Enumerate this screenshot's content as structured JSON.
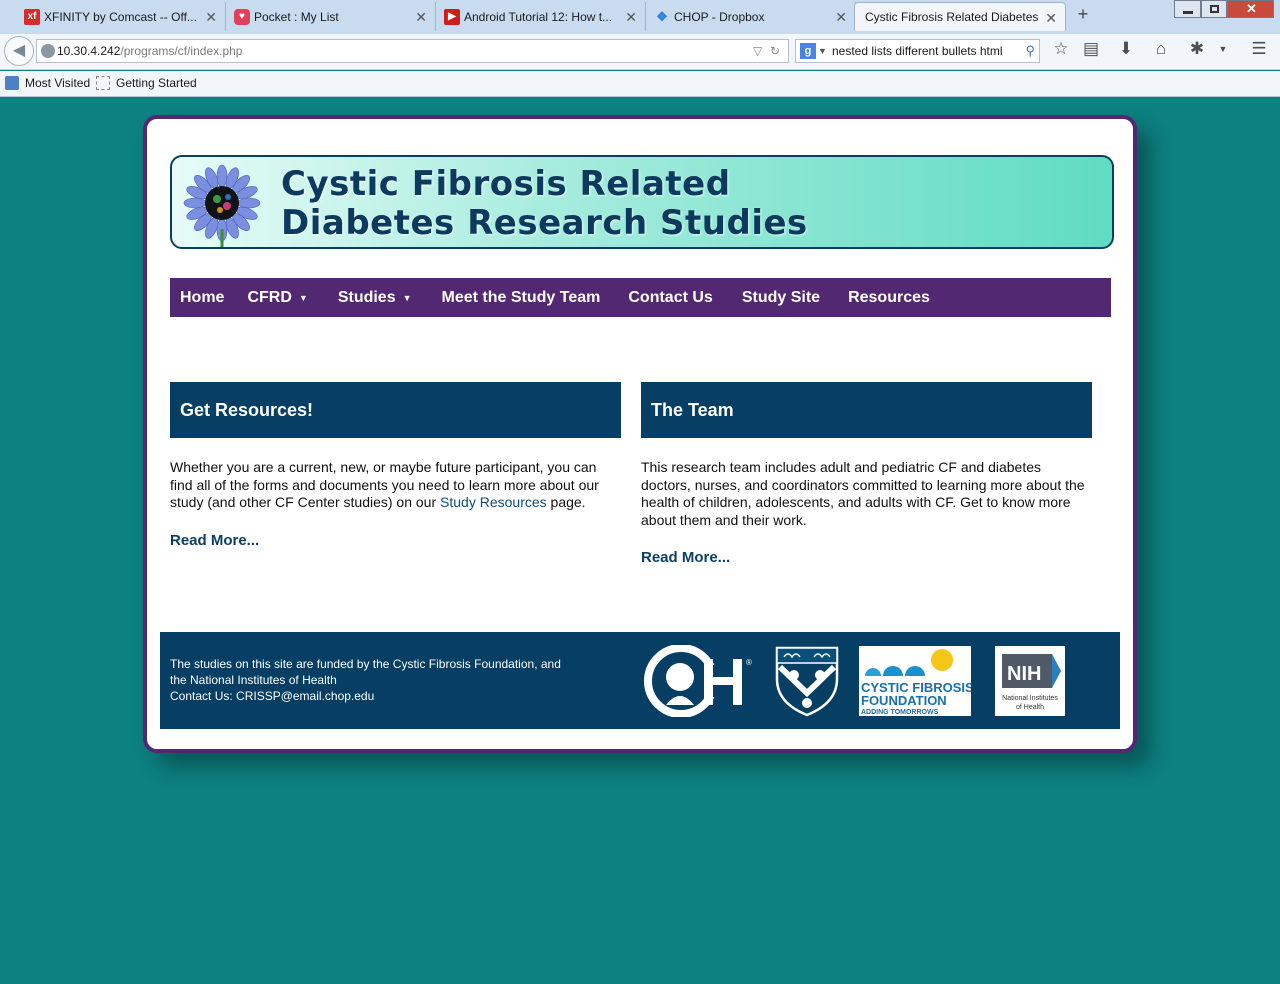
{
  "browser": {
    "tabs": [
      {
        "label": "XFINITY by Comcast -- Off...",
        "icon": "xfinity-icon",
        "active": false
      },
      {
        "label": "Pocket : My List",
        "icon": "pocket-icon",
        "active": false
      },
      {
        "label": "Android Tutorial 12: How t...",
        "icon": "youtube-icon",
        "active": false
      },
      {
        "label": "CHOP - Dropbox",
        "icon": "dropbox-icon",
        "active": false
      },
      {
        "label": "Cystic Fibrosis Related Diabetes",
        "icon": "",
        "active": true
      }
    ],
    "favicon_text": {
      "xfinity": "xf"
    },
    "url_host": "10.30.4.242",
    "url_path": "/programs/cf/index.php",
    "search_value": "nested lists different bullets html",
    "search_engine_letter": "g",
    "bookmarks": [
      {
        "label": "Most Visited",
        "icon": "firefox-icon"
      },
      {
        "label": "Getting Started",
        "icon": "blank-page-icon"
      }
    ],
    "toolbar_icons": [
      "star-icon",
      "reading-list-icon",
      "download-icon",
      "home-icon",
      "addon-icon",
      "menu-icon"
    ]
  },
  "site": {
    "banner": {
      "title_line1": "Cystic Fibrosis Related",
      "title_line2": "Diabetes Research Studies",
      "logo_icon": "flower-logo-icon"
    },
    "nav": [
      {
        "label": "Home",
        "dropdown": false
      },
      {
        "label": "CFRD",
        "dropdown": true
      },
      {
        "label": "Studies",
        "dropdown": true
      },
      {
        "label": "Meet the Study Team",
        "dropdown": false
      },
      {
        "label": "Contact Us",
        "dropdown": false
      },
      {
        "label": "Study Site",
        "dropdown": false
      },
      {
        "label": "Resources",
        "dropdown": false
      }
    ],
    "sections": [
      {
        "heading": "Get Resources!",
        "body_before_link": "Whether you are a current, new, or maybe future participant, you can find all of the forms and documents you need to learn more about our study (and other CF Center studies) on our ",
        "link": "Study Resources",
        "body_after_link": " page.",
        "read_more": "Read More..."
      },
      {
        "heading": "The Team",
        "body_before_link": "This research team includes adult and pediatric CF and diabetes doctors, nurses, and coordinators committed to learning more about the health of children, adolescents, and adults with CF. Get to know more about them and their work.",
        "link": "",
        "body_after_link": "",
        "read_more": "Read More..."
      }
    ],
    "footer": {
      "line1": "The studies on this site are funded by the Cystic Fibrosis Foundation, and",
      "line2": "the National Institutes of Health",
      "line3": "Contact Us: CRISSP@email.chop.edu",
      "logos": [
        {
          "name": "chop-logo",
          "text": "H",
          "mark": "®"
        },
        {
          "name": "penn-shield-logo",
          "text": ""
        },
        {
          "name": "cystic-fibrosis-foundation-logo",
          "text_line1": "CYSTIC FIBROSIS",
          "text_line2": "FOUNDATION",
          "text_line3": "ADDING TOMORROWS"
        },
        {
          "name": "nih-logo",
          "text": "NIH",
          "text_line2": "National Institutes",
          "text_line3": "of Health"
        }
      ]
    }
  },
  "colors": {
    "background": "#0d8080",
    "purple": "#532872",
    "navy": "#063f63",
    "banner_teal": "#5fdcc2"
  }
}
